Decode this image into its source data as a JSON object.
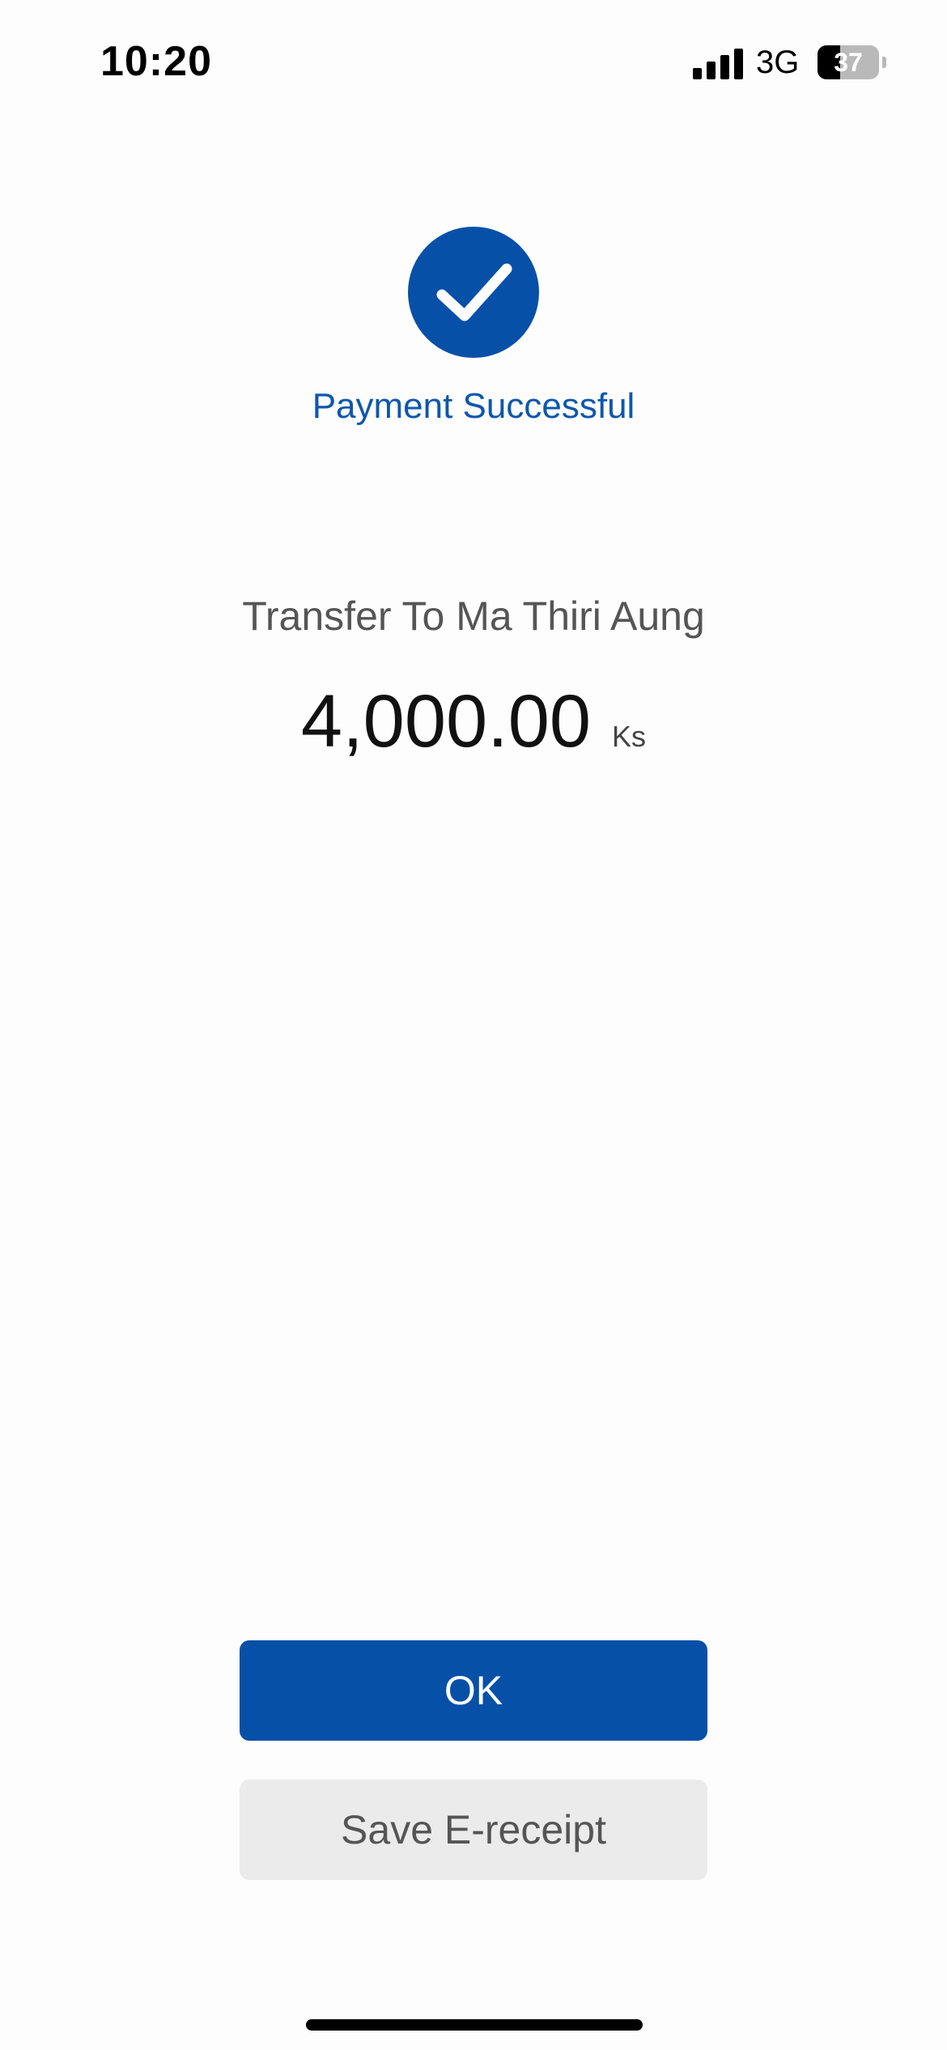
{
  "status_bar": {
    "time": "10:20",
    "network": "3G",
    "battery_level": "37",
    "battery_fraction": 0.37,
    "signal_bars": 4
  },
  "success": {
    "icon": "checkmark-icon",
    "title": "Payment Successful",
    "accent_color": "#0750a8"
  },
  "transfer": {
    "label": "Transfer To Ma Thiri Aung",
    "amount": "4,000.00",
    "currency": "Ks"
  },
  "actions": {
    "ok_label": "OK",
    "save_label": "Save E-receipt"
  }
}
